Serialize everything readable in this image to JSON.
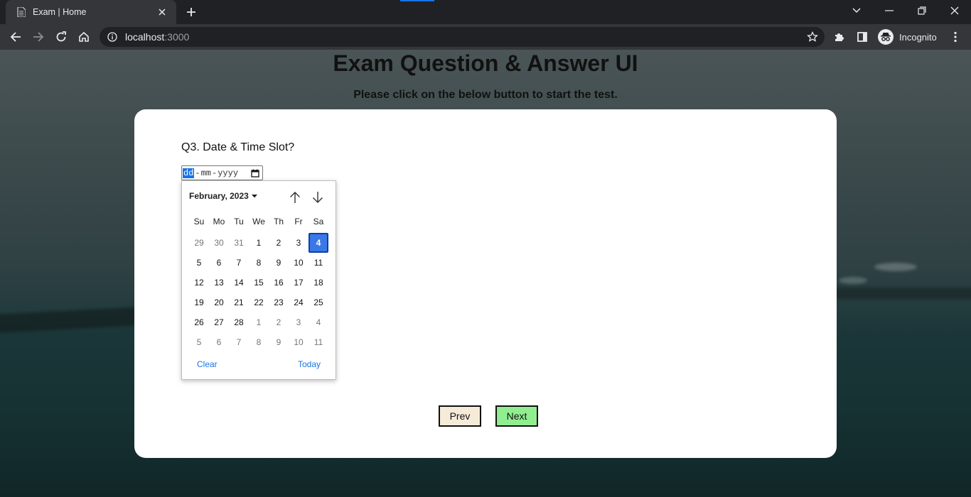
{
  "browser": {
    "tab_title": "Exam | Home",
    "url_host": "localhost",
    "url_port": ":3000",
    "profile_label": "Incognito"
  },
  "page": {
    "title": "Exam Question & Answer UI",
    "subtitle": "Please click on the below button to start the test."
  },
  "question": {
    "text": "Q3. Date & Time Slot?"
  },
  "date_input": {
    "dd": "dd",
    "mm": "mm",
    "yyyy": "yyyy",
    "separator": "-"
  },
  "datepicker": {
    "month_label": "February, 2023",
    "weekdays": [
      "Su",
      "Mo",
      "Tu",
      "We",
      "Th",
      "Fr",
      "Sa"
    ],
    "selected_day": "4",
    "days": [
      {
        "d": "29",
        "out": true
      },
      {
        "d": "30",
        "out": true
      },
      {
        "d": "31",
        "out": true
      },
      {
        "d": "1",
        "out": false
      },
      {
        "d": "2",
        "out": false
      },
      {
        "d": "3",
        "out": false
      },
      {
        "d": "4",
        "out": false,
        "selected": true
      },
      {
        "d": "5",
        "out": false
      },
      {
        "d": "6",
        "out": false
      },
      {
        "d": "7",
        "out": false
      },
      {
        "d": "8",
        "out": false
      },
      {
        "d": "9",
        "out": false
      },
      {
        "d": "10",
        "out": false
      },
      {
        "d": "11",
        "out": false
      },
      {
        "d": "12",
        "out": false
      },
      {
        "d": "13",
        "out": false
      },
      {
        "d": "14",
        "out": false
      },
      {
        "d": "15",
        "out": false
      },
      {
        "d": "16",
        "out": false
      },
      {
        "d": "17",
        "out": false
      },
      {
        "d": "18",
        "out": false
      },
      {
        "d": "19",
        "out": false
      },
      {
        "d": "20",
        "out": false
      },
      {
        "d": "21",
        "out": false
      },
      {
        "d": "22",
        "out": false
      },
      {
        "d": "23",
        "out": false
      },
      {
        "d": "24",
        "out": false
      },
      {
        "d": "25",
        "out": false
      },
      {
        "d": "26",
        "out": false
      },
      {
        "d": "27",
        "out": false
      },
      {
        "d": "28",
        "out": false
      },
      {
        "d": "1",
        "out": true
      },
      {
        "d": "2",
        "out": true
      },
      {
        "d": "3",
        "out": true
      },
      {
        "d": "4",
        "out": true
      },
      {
        "d": "5",
        "out": true
      },
      {
        "d": "6",
        "out": true
      },
      {
        "d": "7",
        "out": true
      },
      {
        "d": "8",
        "out": true
      },
      {
        "d": "9",
        "out": true
      },
      {
        "d": "10",
        "out": true
      },
      {
        "d": "11",
        "out": true
      }
    ],
    "clear_label": "Clear",
    "today_label": "Today"
  },
  "buttons": {
    "prev_label": "Prev",
    "next_label": "Next"
  },
  "colors": {
    "selected_day": "#3b78e7",
    "prev_button": "#f6ebd9",
    "next_button": "#90ee90",
    "link": "#1a73e8"
  }
}
